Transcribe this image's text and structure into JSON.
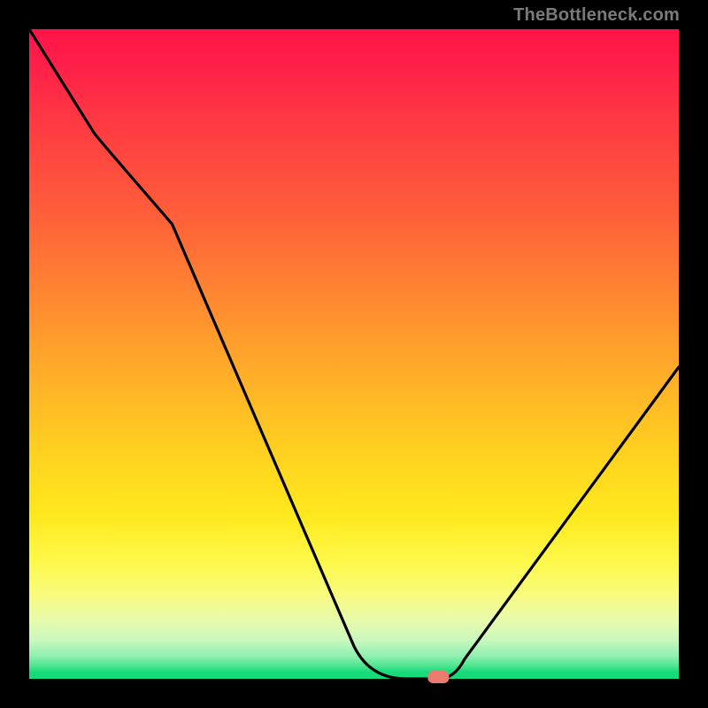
{
  "watermark": "TheBottleneck.com",
  "chart_data": {
    "type": "line",
    "title": "",
    "xlabel": "",
    "ylabel": "",
    "xlim": [
      0,
      100
    ],
    "ylim": [
      0,
      100
    ],
    "grid": false,
    "legend": false,
    "series": [
      {
        "name": "bottleneck-curve",
        "x": [
          0,
          10,
          22,
          50,
          58,
          63,
          67,
          100
        ],
        "values": [
          100,
          84,
          70,
          5,
          0,
          0,
          3,
          48
        ]
      }
    ],
    "marker": {
      "name": "optimal-point",
      "x": 63,
      "y": 0,
      "color": "#eb7a6f",
      "shape": "rounded-rect"
    },
    "background": {
      "type": "vertical-gradient",
      "stops": [
        {
          "pos": 0,
          "color": "#ff1446"
        },
        {
          "pos": 50,
          "color": "#ff9b2c"
        },
        {
          "pos": 80,
          "color": "#fef94a"
        },
        {
          "pos": 100,
          "color": "#15db7a"
        }
      ]
    }
  }
}
